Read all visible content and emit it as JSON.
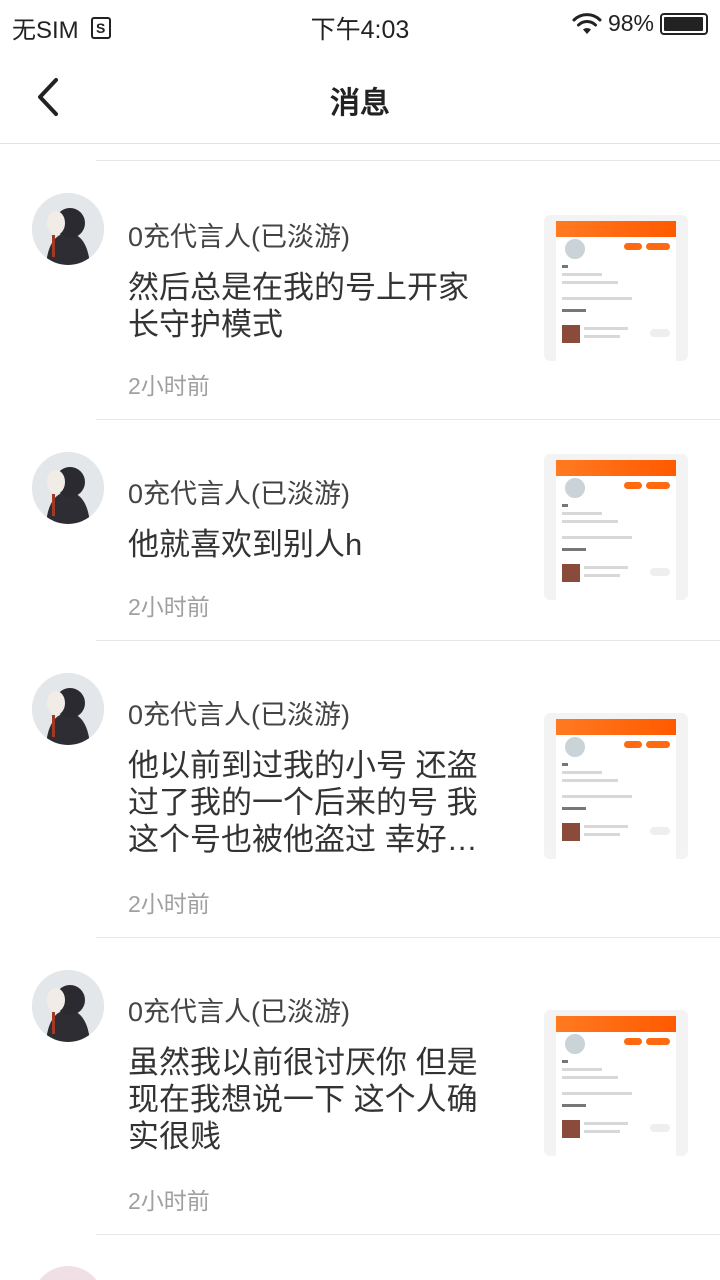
{
  "status_bar": {
    "carrier": "无SIM",
    "sim_icon_glyph": "S",
    "time": "下午4:03",
    "battery_percent": "98%",
    "battery_level": 0.98
  },
  "nav": {
    "back_icon": "chevron-left-icon",
    "title": "消息"
  },
  "messages": [
    {
      "sender": "0充代言人(已淡游)",
      "text": "然后总是在我的号上开家长守护模式",
      "time": "2小时前"
    },
    {
      "sender": "0充代言人(已淡游)",
      "text": "他就喜欢到别人h",
      "time": "2小时前"
    },
    {
      "sender": "0充代言人(已淡游)",
      "text": "他以前到过我的小号 还盗过了我的一个后来的号 我这个号也被他盗过 幸好…",
      "time": "2小时前"
    },
    {
      "sender": "0充代言人(已淡游)",
      "text": "虽然我以前很讨厌你 但是现在我想说一下 这个人确实很贱",
      "time": "2小时前"
    }
  ],
  "colors": {
    "accent": "#ff6a10",
    "separator": "#e6e6e6",
    "time_text": "#a0a0a0"
  }
}
